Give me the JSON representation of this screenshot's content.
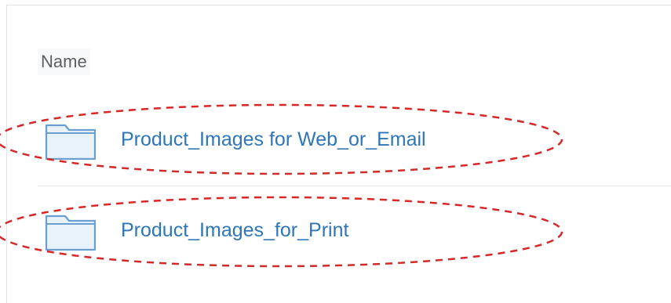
{
  "file_list": {
    "column_header": "Name",
    "items": [
      {
        "label": "Product_Images for Web_or_Email",
        "icon": "folder-icon"
      },
      {
        "label": "Product_Images_for_Print",
        "icon": "folder-icon"
      }
    ]
  },
  "colors": {
    "link": "#2e76b8",
    "folder_fill": "#e8f2fb",
    "folder_stroke": "#6a9fd0",
    "annotation": "#d62828"
  }
}
